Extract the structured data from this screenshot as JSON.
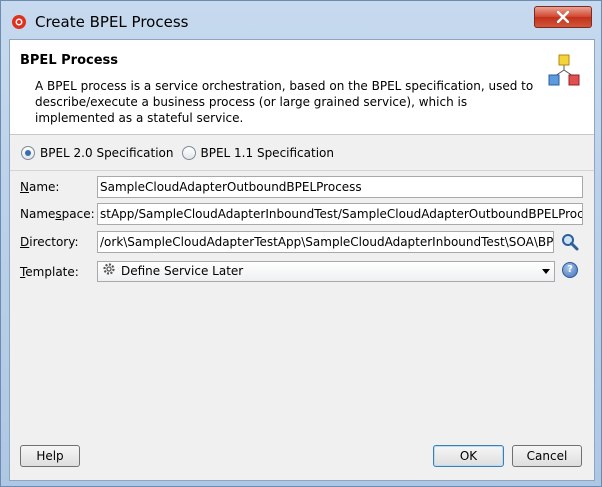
{
  "window": {
    "title": "Create BPEL Process"
  },
  "header": {
    "title": "BPEL Process",
    "description": "A BPEL process is a service orchestration, based on the BPEL specification, used to describe/execute a business process (or large grained service), which is implemented as a stateful service."
  },
  "spec": {
    "options": [
      {
        "label": "BPEL 2.0 Specification",
        "selected": true
      },
      {
        "label": "BPEL 1.1 Specification",
        "selected": false
      }
    ]
  },
  "form": {
    "name": {
      "label_pre": "",
      "label_ul": "N",
      "label_post": "ame:",
      "value": "SampleCloudAdapterOutboundBPELProcess"
    },
    "namespace": {
      "label_pre": "Name",
      "label_ul": "s",
      "label_post": "pace:",
      "value": "stApp/SampleCloudAdapterInboundTest/SampleCloudAdapterOutboundBPELProcess"
    },
    "directory": {
      "label_pre": "",
      "label_ul": "D",
      "label_post": "irectory:",
      "value": "/ork\\SampleCloudAdapterTestApp\\SampleCloudAdapterInboundTest\\SOA\\BPEL"
    },
    "template": {
      "label_pre": "",
      "label_ul": "T",
      "label_post": "emplate:",
      "value": "Define Service Later"
    }
  },
  "buttons": {
    "help": "Help",
    "ok": "OK",
    "cancel": "Cancel"
  },
  "icons": {
    "app": "oracle-jdeveloper-icon",
    "close": "close-icon",
    "header": "bpel-process-icon",
    "browse": "search-icon",
    "template": "gear-icon",
    "help": "help-icon"
  },
  "colors": {
    "accent": "#3a6db0",
    "close": "#c1321b"
  }
}
